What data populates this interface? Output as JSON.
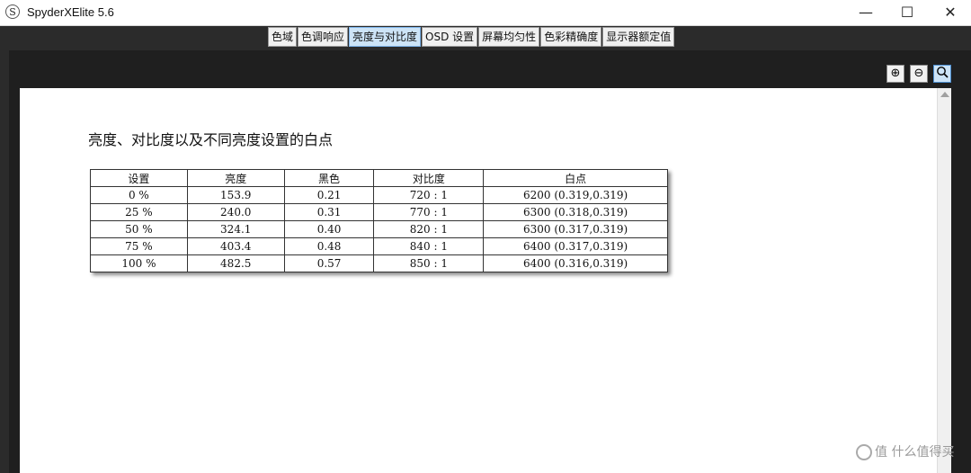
{
  "window": {
    "title": "SpyderXElite 5.6",
    "icon_letter": "S",
    "minimize": "—",
    "maximize": "☐",
    "close": "✕"
  },
  "tabs": [
    {
      "label": "色域",
      "active": false
    },
    {
      "label": "色调响应",
      "active": false
    },
    {
      "label": "亮度与对比度",
      "active": true
    },
    {
      "label": "OSD 设置",
      "active": false
    },
    {
      "label": "屏幕均匀性",
      "active": false
    },
    {
      "label": "色彩精确度",
      "active": false
    },
    {
      "label": "显示器额定值",
      "active": false
    }
  ],
  "zoom": {
    "in": "⊕",
    "out": "⊖",
    "fit": "🔍"
  },
  "document": {
    "title": "亮度、对比度以及不同亮度设置的白点",
    "table": {
      "headers": [
        "设置",
        "亮度",
        "黑色",
        "对比度",
        "白点"
      ],
      "rows": [
        [
          "0 %",
          "153.9",
          "0.21",
          "720 : 1",
          "6200 (0.319,0.319)"
        ],
        [
          "25 %",
          "240.0",
          "0.31",
          "770 : 1",
          "6300 (0.318,0.319)"
        ],
        [
          "50 %",
          "324.1",
          "0.40",
          "820 : 1",
          "6300 (0.317,0.319)"
        ],
        [
          "75 %",
          "403.4",
          "0.48",
          "840 : 1",
          "6400 (0.317,0.319)"
        ],
        [
          "100 %",
          "482.5",
          "0.57",
          "850 : 1",
          "6400 (0.316,0.319)"
        ]
      ]
    }
  },
  "watermark": "值 什么值得买"
}
